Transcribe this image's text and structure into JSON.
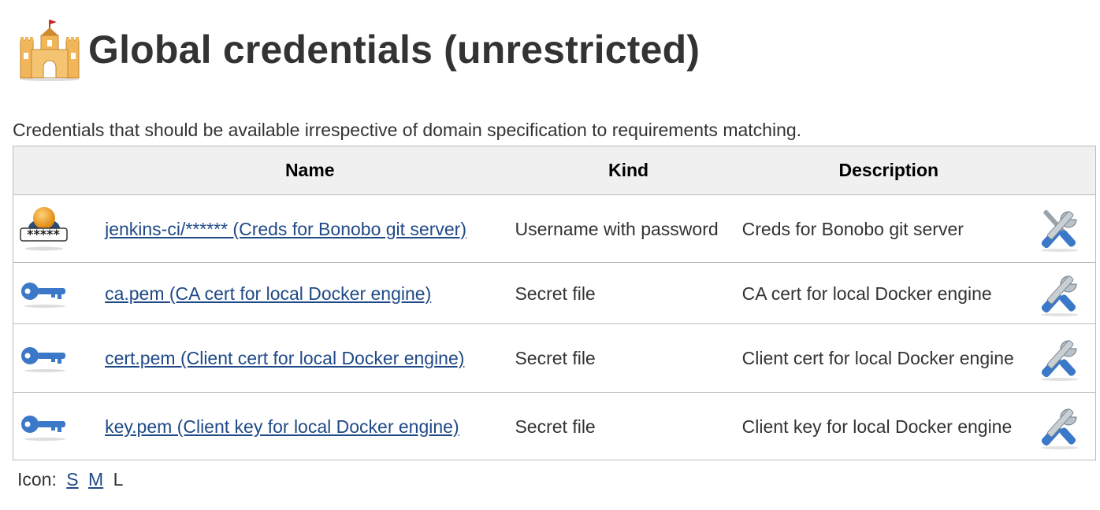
{
  "page": {
    "title": "Global credentials (unrestricted)",
    "description": "Credentials that should be available irrespective of domain specification to requirements matching."
  },
  "table": {
    "columns": [
      "",
      "Name",
      "Kind",
      "Description",
      ""
    ],
    "rows": [
      {
        "icon": "user-password-icon",
        "name": "jenkins-ci/****** (Creds for Bonobo git server)",
        "kind": "Username with password",
        "description": "Creds for Bonobo git server",
        "action_icon": "configure-tools-icon"
      },
      {
        "icon": "key-icon",
        "name": "ca.pem (CA cert for local Docker engine)",
        "kind": "Secret file",
        "description": "CA cert for local Docker engine",
        "action_icon": "configure-tools-icon"
      },
      {
        "icon": "key-icon",
        "name": "cert.pem (Client cert for local Docker engine)",
        "kind": "Secret file",
        "description": "Client cert for local Docker engine",
        "action_icon": "configure-tools-icon"
      },
      {
        "icon": "key-icon",
        "name": "key.pem (Client key for local Docker engine)",
        "kind": "Secret file",
        "description": "Client key for local Docker engine",
        "action_icon": "configure-tools-icon"
      }
    ]
  },
  "footer": {
    "label": "Icon:",
    "sizes": [
      "S",
      "M",
      "L"
    ],
    "current": "L"
  },
  "icons": {
    "header": "castle-icon"
  },
  "colors": {
    "link": "#204a87",
    "header_bg": "#f0f0f0",
    "border": "#bbbbbb"
  }
}
